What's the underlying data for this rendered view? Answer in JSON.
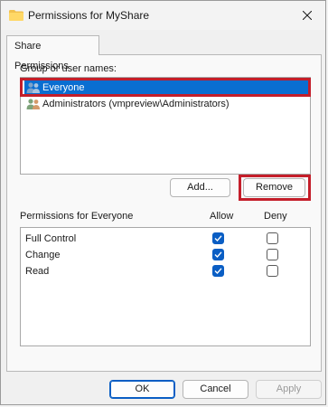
{
  "window": {
    "title": "Permissions for MyShare"
  },
  "tabs": [
    {
      "label": "Share Permissions"
    }
  ],
  "groups": {
    "label": "Group or user names:",
    "items": [
      {
        "label": "Everyone",
        "selected": true
      },
      {
        "label": "Administrators (vmpreview\\Administrators)",
        "selected": false
      }
    ]
  },
  "buttons": {
    "add": "Add...",
    "remove": "Remove",
    "ok": "OK",
    "cancel": "Cancel",
    "apply": "Apply"
  },
  "permissions": {
    "title": "Permissions for Everyone",
    "allow_header": "Allow",
    "deny_header": "Deny",
    "rows": [
      {
        "name": "Full Control",
        "allow": true,
        "deny": false
      },
      {
        "name": "Change",
        "allow": true,
        "deny": false
      },
      {
        "name": "Read",
        "allow": true,
        "deny": false
      }
    ]
  },
  "colors": {
    "accent": "#0a5ec4",
    "selection": "#0a6ed1",
    "highlight": "#c41e2a"
  }
}
